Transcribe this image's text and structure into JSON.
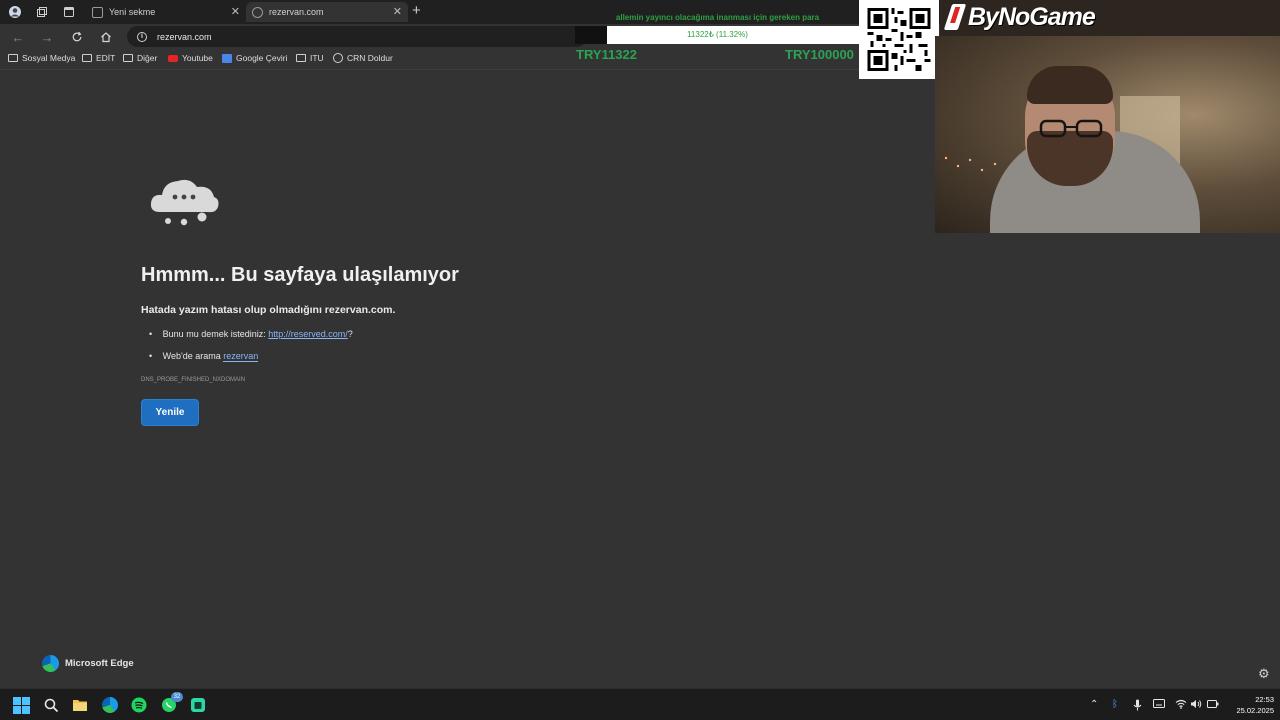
{
  "browser": {
    "tabs": [
      {
        "label": "Yeni sekme",
        "active": false
      },
      {
        "label": "rezervan.com",
        "active": true
      }
    ],
    "address": "rezervan.com",
    "favorites": [
      "Sosyal Medya",
      "EDİT",
      "Diğer",
      "Youtube",
      "Google Çeviri",
      "ITU",
      "CRN Doldur"
    ]
  },
  "donation": {
    "title": "allemin yayıncı olacağıma inanması için gereken para",
    "progress_text": "11322₺ (11.32%)",
    "progress_fraction": 0.1132,
    "min_label": "TRY11322",
    "max_label": "TRY100000"
  },
  "stream": {
    "logo": "ByNoGame"
  },
  "error_page": {
    "title": "Hmmm... Bu sayfaya ulaşılamıyor",
    "subtitle": "Hatada yazım hatası olup olmadığını rezervan.com.",
    "suggestion_prefix": "Bunu mu demek istediniz:",
    "suggestion_link": "http://reserved.com/",
    "suggestion_suffix": "?",
    "search_prefix": "Web'de arama",
    "search_link": "rezervan",
    "error_code": "DNS_PROBE_FINISHED_NXDOMAIN",
    "reload_label": "Yenile"
  },
  "footer": {
    "brand": "Microsoft Edge"
  },
  "taskbar": {
    "whatsapp_badge": "32",
    "time": "22:53",
    "date": "25.02.2025"
  },
  "colors": {
    "page_bg": "#333333",
    "link": "#8ab4f8",
    "button": "#1f6fc0",
    "donation_green": "#2aa353"
  }
}
